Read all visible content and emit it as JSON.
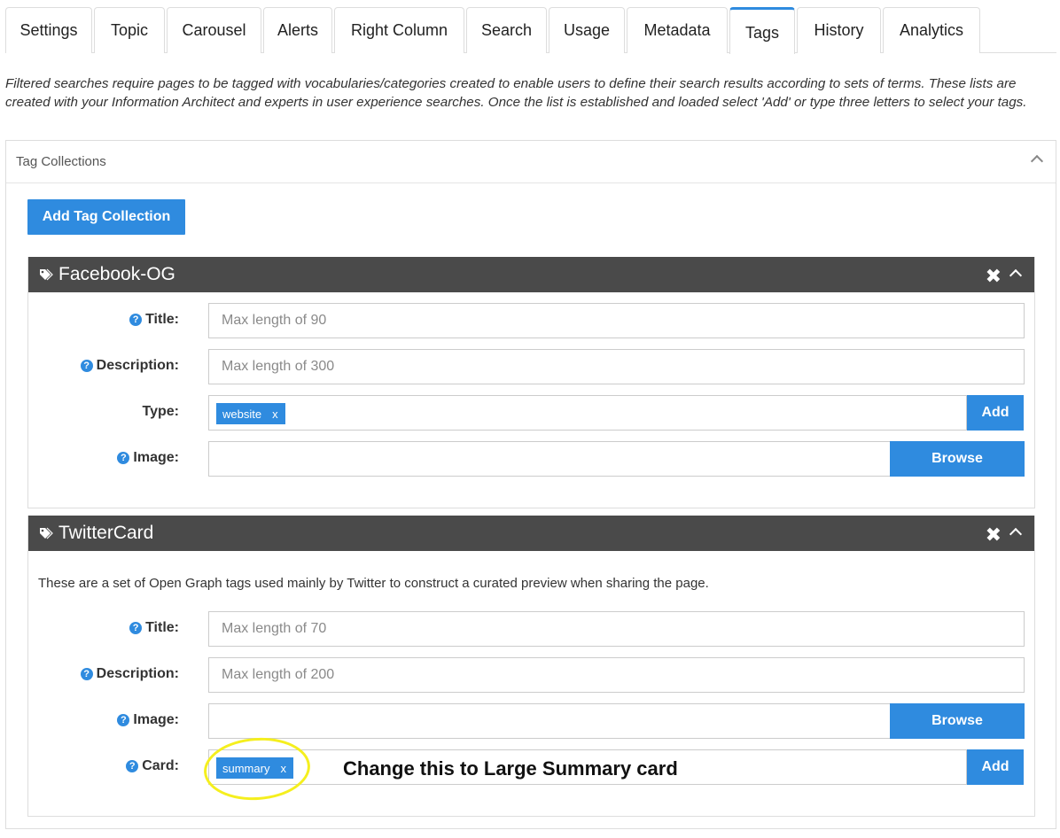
{
  "tabs": [
    {
      "label": "Settings",
      "active": false
    },
    {
      "label": "Topic",
      "active": false
    },
    {
      "label": "Carousel",
      "active": false
    },
    {
      "label": "Alerts",
      "active": false
    },
    {
      "label": "Right Column",
      "active": false
    },
    {
      "label": "Search",
      "active": false
    },
    {
      "label": "Usage",
      "active": false
    },
    {
      "label": "Metadata",
      "active": false
    },
    {
      "label": "Tags",
      "active": true
    },
    {
      "label": "History",
      "active": false
    },
    {
      "label": "Analytics",
      "active": false
    }
  ],
  "intro": "Filtered searches require pages to be tagged with vocabularies/categories created to enable users to define their search results according to sets of terms. These lists are created with your Information Architect and experts in user experience searches. Once the list is established and loaded select 'Add' or type three letters to select your tags.",
  "panel": {
    "title": "Tag Collections",
    "add_button": "Add Tag Collection"
  },
  "facebook": {
    "title": "Facebook-OG",
    "close": "✖",
    "title_label": "Title:",
    "title_placeholder": "Max length of 90",
    "description_label": "Description:",
    "description_placeholder": "Max length of 300",
    "type_label": "Type:",
    "type_tag": "website",
    "tag_remove": "x",
    "add_button": "Add",
    "image_label": "Image:",
    "browse_button": "Browse"
  },
  "twitter": {
    "title": "TwitterCard",
    "close": "✖",
    "description_text": "These are a set of Open Graph tags used mainly by Twitter to construct a curated preview when sharing the page.",
    "title_label": "Title:",
    "title_placeholder": "Max length of 70",
    "description_label": "Description:",
    "description_placeholder": "Max length of 200",
    "image_label": "Image:",
    "browse_button": "Browse",
    "card_label": "Card:",
    "card_tag": "summary",
    "tag_remove": "x",
    "add_button": "Add"
  },
  "annotation": "Change this to Large Summary card",
  "colors": {
    "accent": "#2f8bdf",
    "bar": "#4a4a4a",
    "highlight": "#f5ef1e"
  }
}
